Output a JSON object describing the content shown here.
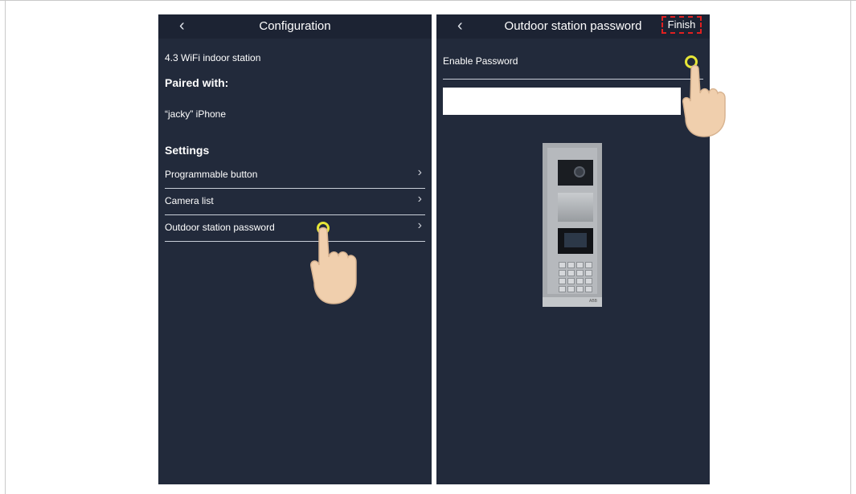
{
  "left_screen": {
    "title": "Configuration",
    "back_icon": "chevron-left-icon",
    "device_name": "4.3 WiFi indoor station",
    "paired_heading": "Paired with:",
    "paired_device": "“jacky” iPhone",
    "settings_heading": "Settings",
    "items": [
      {
        "label": "Programmable button",
        "icon": "chevron-right-icon"
      },
      {
        "label": "Camera list",
        "icon": "chevron-right-icon"
      },
      {
        "label": "Outdoor station password",
        "icon": "chevron-right-icon"
      }
    ]
  },
  "right_screen": {
    "title": "Outdoor station password",
    "back_icon": "chevron-left-icon",
    "finish_label": "Finish",
    "enable_password_label": "Enable Password",
    "password_value": ""
  },
  "glyphs": {
    "chevron_left": "‹",
    "chevron_right": "›"
  },
  "outdoor_station": {
    "keypad_keys": [
      "1",
      "2",
      "3",
      "4",
      "5",
      "6",
      "7",
      "8",
      "9",
      "*",
      "0",
      "#",
      "←",
      "→",
      "↑",
      "↓"
    ],
    "logo_text": "ABB"
  },
  "colors": {
    "screen_bg": "#222a3b",
    "navbar_bg": "#1c2333",
    "highlight_circle": "#e6e637",
    "finish_outline": "#e02020"
  }
}
